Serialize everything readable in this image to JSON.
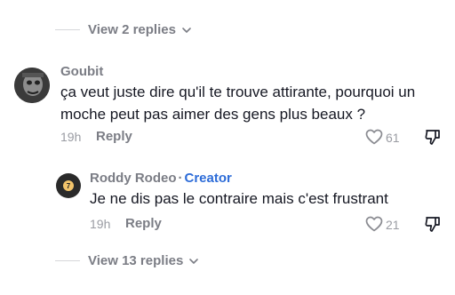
{
  "thread": {
    "top_view_replies": "View 2 replies",
    "bottom_view_replies": "View 13 replies"
  },
  "comment": {
    "username": "Goubit",
    "text": "ça veut juste dire qu'il te trouve attirante, pourquoi un moche peut pas aimer des gens plus beaux ?",
    "time": "19h",
    "reply_label": "Reply",
    "likes": "61",
    "like_icon": "heart-outline-icon",
    "dislike_icon": "thumb-down-icon"
  },
  "reply": {
    "username": "Roddy Rodeo",
    "separator": "·",
    "badge": "Creator",
    "text": "Je ne dis pas le contraire mais c'est frustrant",
    "time": "19h",
    "reply_label": "Reply",
    "likes": "21",
    "avatar_glyph": "7"
  },
  "colors": {
    "creator_badge": "#2d6cd8",
    "secondary_text": "#7b7d85",
    "primary_text": "#161823"
  }
}
